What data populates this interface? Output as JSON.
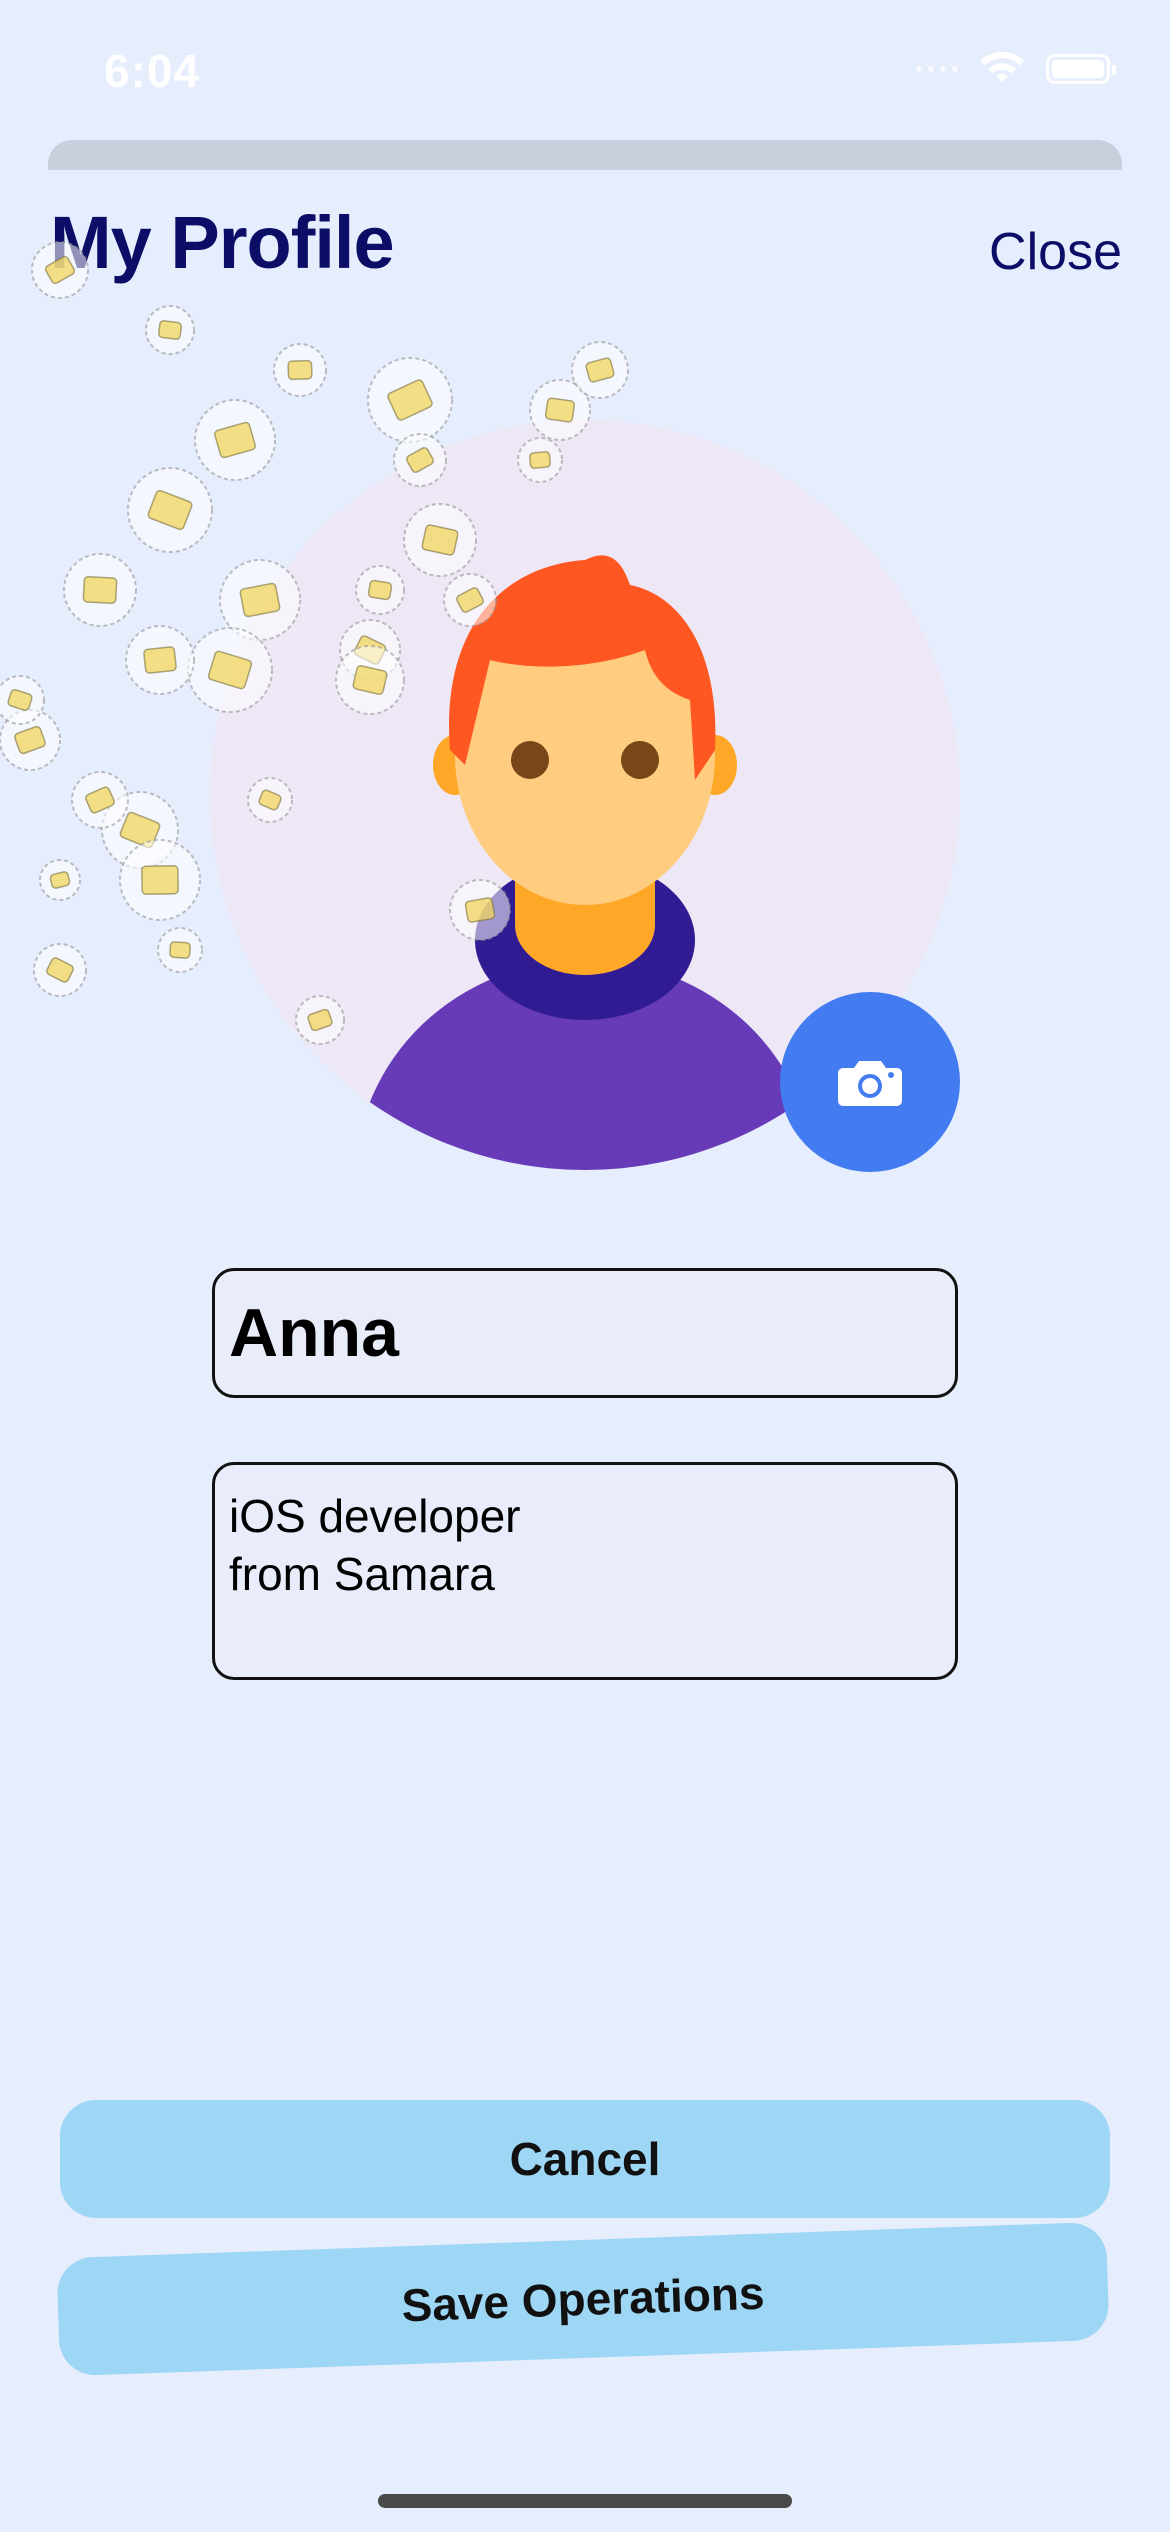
{
  "status_bar": {
    "time": "6:04"
  },
  "header": {
    "title": "My Profile",
    "close_label": "Close"
  },
  "profile": {
    "name": "Anna",
    "bio_lines": [
      "iOS developer",
      "from Samara"
    ]
  },
  "actions": {
    "cancel_label": "Cancel",
    "save_label": "Save Operations"
  },
  "icons": {
    "camera": "camera-icon",
    "wifi": "wifi-icon",
    "battery": "battery-icon",
    "avatar": "person-avatar-icon"
  },
  "colors": {
    "background": "#e6edfd",
    "title": "#0c0d66",
    "camera_button": "#427cf0",
    "action_button": "#9dd7f5",
    "avatar_bg": "#ede7f6"
  }
}
